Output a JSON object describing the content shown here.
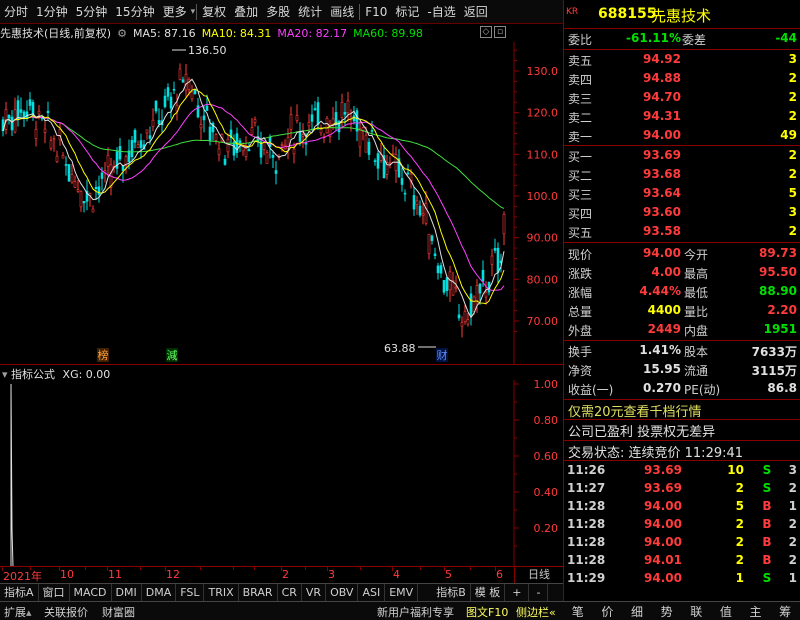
{
  "toolbar": {
    "items": [
      "分时",
      "1分钟",
      "5分钟",
      "15分钟",
      "更多",
      "复权",
      "叠加",
      "多股",
      "统计",
      "画线",
      "F10",
      "标记",
      "-自选",
      "返回"
    ]
  },
  "main_chart": {
    "title": "先惠技术(日线,前复权)",
    "ma5": "MA5: 87.16",
    "ma10": "MA10: 84.31",
    "ma20": "MA20: 82.17",
    "ma60": "MA60: 89.98",
    "high_label": "136.50",
    "low_label": "63.88",
    "yticks": [
      "130.0",
      "120.0",
      "110.0",
      "100.0",
      "90.00",
      "80.00",
      "70.00"
    ],
    "marker_bang": "榜",
    "marker_jian": "減",
    "marker_cai": "财",
    "colors": {
      "up": "#ff3b3b",
      "down": "#00e0e0",
      "ma5": "#e0e0e0",
      "ma10": "#ffff00",
      "ma20": "#ff40ff",
      "ma60": "#40e040"
    }
  },
  "indicator": {
    "title": "指标公式",
    "xg": "XG: 0.00",
    "yticks": [
      "1.00",
      "0.80",
      "0.60",
      "0.40",
      "0.20"
    ]
  },
  "xaxis": {
    "labels": [
      "2021年",
      "10",
      "11",
      "12",
      "2",
      "3",
      "4",
      "5",
      "6"
    ],
    "period": "日线"
  },
  "bottom_tabs": [
    "指标A",
    "窗口",
    "MACD",
    "DMI",
    "DMA",
    "FSL",
    "TRIX",
    "BRAR",
    "CR",
    "VR",
    "OBV",
    "ASI",
    "EMV",
    "指标B",
    "模 板",
    "+",
    "-"
  ],
  "bottom_bar": {
    "expand": "扩展",
    "related": "关联报价",
    "wealth": "财富圈",
    "promo": "新用户福利专享",
    "f10": "图文F10",
    "side": "侧边栏"
  },
  "stock": {
    "kr": "KR",
    "code": "688155",
    "name": "先惠技术"
  },
  "order_book": {
    "weibi_label": "委比",
    "weibi_value": "-61.11%",
    "weicha_label": "委差",
    "weicha_value": "-44",
    "sells": [
      {
        "label": "卖五",
        "price": "94.92",
        "vol": "3"
      },
      {
        "label": "卖四",
        "price": "94.88",
        "vol": "2"
      },
      {
        "label": "卖三",
        "price": "94.70",
        "vol": "2"
      },
      {
        "label": "卖二",
        "price": "94.31",
        "vol": "2"
      },
      {
        "label": "卖一",
        "price": "94.00",
        "vol": "49"
      }
    ],
    "buys": [
      {
        "label": "买一",
        "price": "93.69",
        "vol": "2"
      },
      {
        "label": "买二",
        "price": "93.68",
        "vol": "2"
      },
      {
        "label": "买三",
        "price": "93.64",
        "vol": "5"
      },
      {
        "label": "买四",
        "price": "93.60",
        "vol": "3"
      },
      {
        "label": "买五",
        "price": "93.58",
        "vol": "2"
      }
    ]
  },
  "quote": [
    {
      "l1": "现价",
      "v1": "94.00",
      "l2": "今开",
      "v2": "89.73"
    },
    {
      "l1": "涨跌",
      "v1": "4.00",
      "l2": "最高",
      "v2": "95.50"
    },
    {
      "l1": "涨幅",
      "v1": "4.44%",
      "l2": "最低",
      "v2": "88.90"
    },
    {
      "l1": "总量",
      "v1": "4400",
      "l2": "量比",
      "v2": "2.20"
    },
    {
      "l1": "外盘",
      "v1": "2449",
      "l2": "内盘",
      "v2": "1951"
    }
  ],
  "fundamentals": [
    {
      "l1": "换手",
      "v1": "1.41%",
      "l2": "股本",
      "v2": "7633万"
    },
    {
      "l1": "净资",
      "v1": "15.95",
      "l2": "流通",
      "v2": "3115万"
    },
    {
      "l1": "收益(一)",
      "v1": "0.270",
      "l2": "PE(动)",
      "v2": "86.8"
    }
  ],
  "promo_line": "仅需20元查看千档行情",
  "company_line": "公司已盈利 投票权无差异",
  "trade_status": "交易状态: 连续竞价 11:29:41",
  "trades": [
    {
      "time": "11:26",
      "price": "93.69",
      "vol": "10",
      "bs": "S",
      "cnt": "3"
    },
    {
      "time": "11:27",
      "price": "93.69",
      "vol": "2",
      "bs": "S",
      "cnt": "2"
    },
    {
      "time": "11:28",
      "price": "94.00",
      "vol": "5",
      "bs": "B",
      "cnt": "1"
    },
    {
      "time": "11:28",
      "price": "94.00",
      "vol": "2",
      "bs": "B",
      "cnt": "2"
    },
    {
      "time": "11:28",
      "price": "94.00",
      "vol": "2",
      "bs": "B",
      "cnt": "2"
    },
    {
      "time": "11:28",
      "price": "94.01",
      "vol": "2",
      "bs": "B",
      "cnt": "2"
    },
    {
      "time": "11:29",
      "price": "94.00",
      "vol": "1",
      "bs": "S",
      "cnt": "1"
    }
  ],
  "right_icons": [
    "笔",
    "价",
    "细",
    "势",
    "联",
    "值",
    "主",
    "筹"
  ]
}
